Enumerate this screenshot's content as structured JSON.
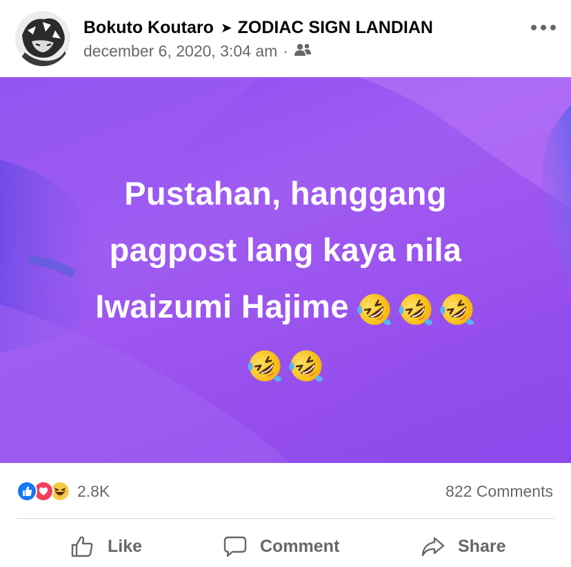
{
  "post": {
    "author": "Bokuto Koutaro",
    "separator_icon": "arrow-right-icon",
    "group": "ZODIAC SIGN LANDIAN",
    "timestamp": "december 6, 2020, 3:04 am",
    "audience_icon": "group-icon",
    "more_icon": "more-horizontal-icon",
    "text_lines": [
      "Pustahan, hanggang",
      "pagpost lang kaya nila",
      "Iwaizumi Hajime"
    ],
    "emoji_name": "rolling-on-floor-laughing",
    "emoji_count_line3": 3,
    "emoji_count_line4": 2,
    "background_color": "#9a55ef"
  },
  "stats": {
    "reaction_icons": [
      "like-reaction-icon",
      "love-reaction-icon",
      "haha-reaction-icon"
    ],
    "reactions_count": "2.8K",
    "comments_count": "822 Comments"
  },
  "actions": {
    "like_label": "Like",
    "comment_label": "Comment",
    "share_label": "Share"
  },
  "colors": {
    "like_blue": "#1877f2",
    "love_red": "#f33e58",
    "text_gray": "#65676b"
  }
}
